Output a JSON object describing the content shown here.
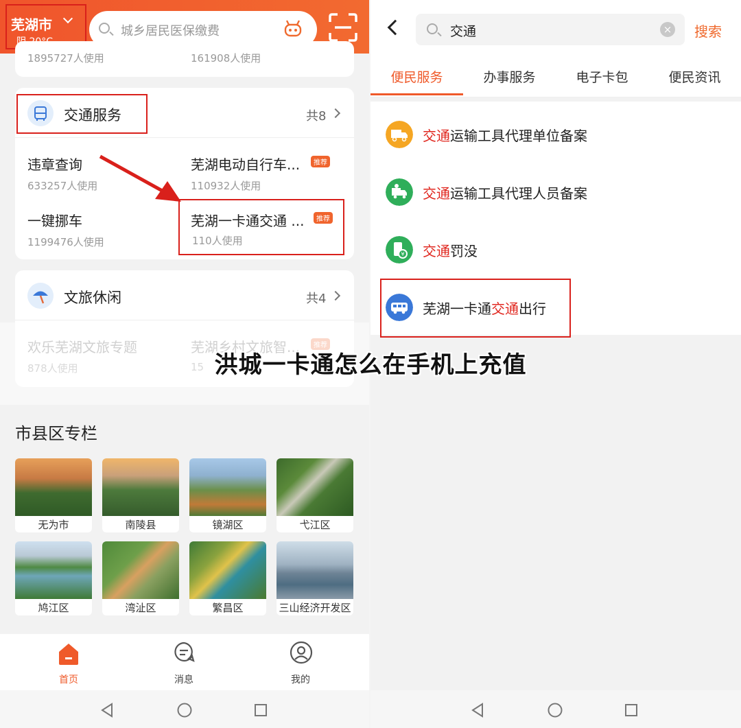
{
  "left": {
    "city": "芜湖市",
    "weather": "阴 20°C",
    "search_placeholder": "城乡居民医保缴费",
    "top_usage": [
      "1895727人使用",
      "161908人使用"
    ],
    "traffic": {
      "title": "交通服务",
      "count": "共8",
      "items": [
        {
          "title": "违章查询",
          "usage": "633257人使用",
          "tag": ""
        },
        {
          "title": "芜湖电动自行车...",
          "usage": "110932人使用",
          "tag": "推荐"
        },
        {
          "title": "一键挪车",
          "usage": "1199476人使用",
          "tag": ""
        },
        {
          "title": "芜湖一卡通交通 ...",
          "usage": "110人使用",
          "tag": "推荐"
        }
      ]
    },
    "culture": {
      "title": "文旅休闲",
      "count": "共4",
      "items": [
        {
          "title": "欢乐芜湖文旅专题",
          "usage": "878人使用",
          "tag": ""
        },
        {
          "title": "芜湖乡村文旅智...",
          "usage": "15",
          "tag": "推荐"
        }
      ]
    },
    "districts_title": "市县区专栏",
    "districts": [
      "无为市",
      "南陵县",
      "镜湖区",
      "弋江区",
      "鸠江区",
      "湾沚区",
      "繁昌区",
      "三山经济开发区"
    ],
    "tabbar": [
      {
        "label": "首页",
        "icon": "home-icon"
      },
      {
        "label": "消息",
        "icon": "message-icon"
      },
      {
        "label": "我的",
        "icon": "profile-icon"
      }
    ]
  },
  "right": {
    "search_value": "交通",
    "search_button": "搜索",
    "tabs": [
      "便民服务",
      "办事服务",
      "电子卡包",
      "便民资讯"
    ],
    "results": [
      {
        "pre": "",
        "hl": "交通",
        "post": "运输工具代理单位备案",
        "color": "#f5a623",
        "icon": "truck-icon"
      },
      {
        "pre": "",
        "hl": "交通",
        "post": "运输工具代理人员备案",
        "color": "#2fae5a",
        "icon": "truck-person-icon"
      },
      {
        "pre": "",
        "hl": "交通",
        "post": "罚没",
        "color": "#2fae5a",
        "icon": "fine-icon"
      },
      {
        "pre": "芜湖一卡通",
        "hl": "交通",
        "post": "出行",
        "color": "#3a78d8",
        "icon": "bus-icon"
      }
    ]
  },
  "overlay_title": "洪城一卡通怎么在手机上充值",
  "colors": {
    "accent": "#ef5a2a",
    "highlight_red": "#d9201b"
  }
}
